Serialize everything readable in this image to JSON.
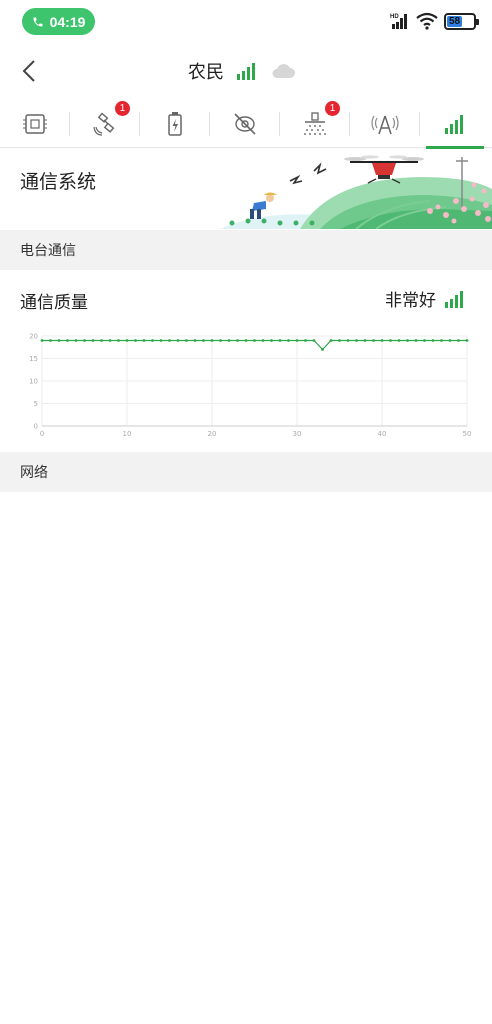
{
  "status_bar": {
    "call_time": "04:19",
    "battery_level": "58",
    "network_tag": "HD"
  },
  "header": {
    "title": "农民"
  },
  "tabs": [
    {
      "icon": "chip-icon",
      "badge": ""
    },
    {
      "icon": "satellite-icon",
      "badge": "1"
    },
    {
      "icon": "battery-icon",
      "badge": ""
    },
    {
      "icon": "sensor-off-icon",
      "badge": ""
    },
    {
      "icon": "sprayer-icon",
      "badge": "1"
    },
    {
      "icon": "antenna-icon",
      "badge": ""
    },
    {
      "icon": "signal-icon",
      "badge": "",
      "active": true
    }
  ],
  "banner": {
    "title": "通信系统"
  },
  "sections": {
    "radio": "电台通信",
    "network": "网络"
  },
  "quality": {
    "label": "通信质量",
    "value": "非常好"
  },
  "colors": {
    "accent": "#2fa84b",
    "badge": "#e6262e",
    "pill": "#3fc46e"
  },
  "chart_data": {
    "type": "line",
    "x": [
      0,
      1,
      2,
      3,
      4,
      5,
      6,
      7,
      8,
      9,
      10,
      11,
      12,
      13,
      14,
      15,
      16,
      17,
      18,
      19,
      20,
      21,
      22,
      23,
      24,
      25,
      26,
      27,
      28,
      29,
      30,
      31,
      32,
      33,
      34,
      35,
      36,
      37,
      38,
      39,
      40,
      41,
      42,
      43,
      44,
      45,
      46,
      47,
      48,
      49,
      50
    ],
    "series": [
      {
        "values": [
          19,
          19,
          19,
          19,
          19,
          19,
          19,
          19,
          19,
          19,
          19,
          19,
          19,
          19,
          19,
          19,
          19,
          19,
          19,
          19,
          19,
          19,
          19,
          19,
          19,
          19,
          19,
          19,
          19,
          19,
          19,
          19,
          19,
          17,
          19,
          19,
          19,
          19,
          19,
          19,
          19,
          19,
          19,
          19,
          19,
          19,
          19,
          19,
          19,
          19,
          19
        ]
      }
    ],
    "xticks": [
      "0",
      "10",
      "20",
      "30",
      "40",
      "50"
    ],
    "yticks": [
      "0",
      "5",
      "10",
      "15",
      "20"
    ],
    "xlim": [
      0,
      50
    ],
    "ylim": [
      0,
      20
    ],
    "grid": true
  }
}
